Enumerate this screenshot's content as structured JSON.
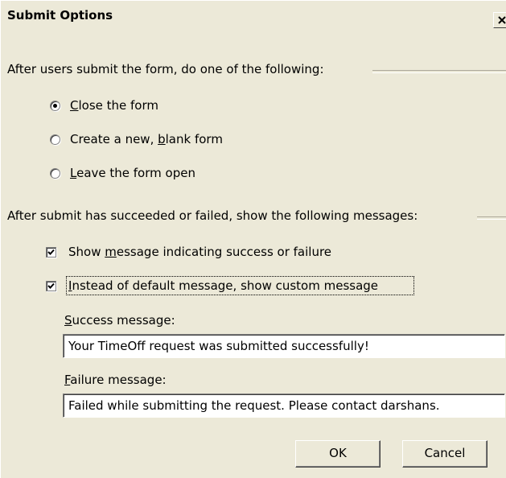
{
  "window": {
    "title": "Submit Options",
    "close_glyph": "X"
  },
  "after_submit": {
    "heading": "After users submit the form, do one of the following:",
    "options": [
      {
        "pre": "",
        "key": "C",
        "post": "lose the form",
        "selected": true
      },
      {
        "pre": "Create a new, ",
        "key": "b",
        "post": "lank form",
        "selected": false
      },
      {
        "pre": "",
        "key": "L",
        "post": "eave the form open",
        "selected": false
      }
    ]
  },
  "messages": {
    "heading": "After submit has succeeded or failed, show the following messages:",
    "show_message": {
      "pre": "Show ",
      "key": "m",
      "post": "essage indicating success or failure",
      "checked": true
    },
    "custom_message": {
      "pre": "",
      "key": "I",
      "post": "nstead of default message, show custom message",
      "checked": true
    },
    "success_label": {
      "key": "S",
      "post": "uccess message:"
    },
    "success_value": "Your TimeOff request was submitted successfully!",
    "failure_label": {
      "key": "F",
      "post": "ailure message:"
    },
    "failure_value": "Failed while submitting the request. Please contact darshans."
  },
  "buttons": {
    "ok": "OK",
    "cancel": "Cancel"
  }
}
